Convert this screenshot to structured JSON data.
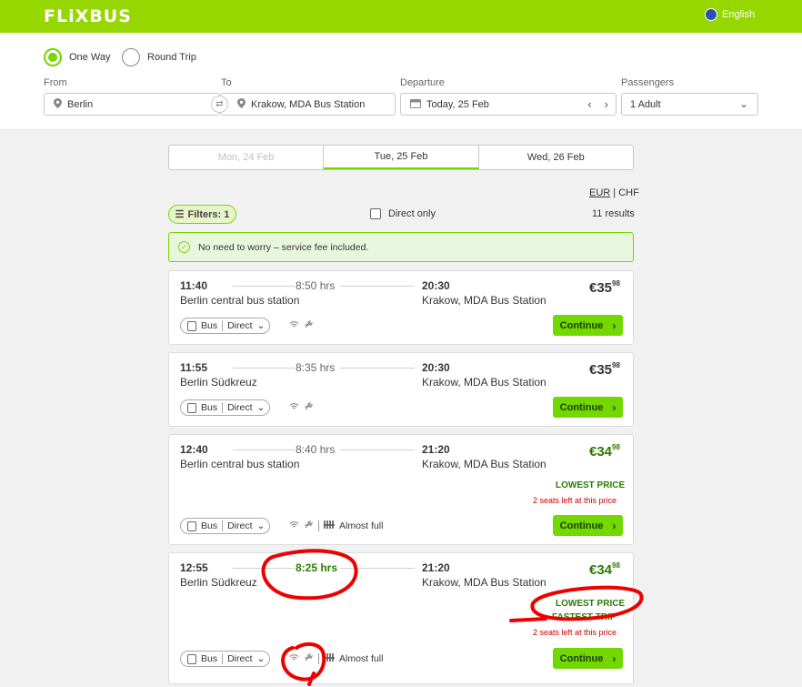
{
  "header": {
    "logo": "FLiXBUS",
    "language": "English"
  },
  "search": {
    "trip_types": [
      "One Way",
      "Round Trip"
    ],
    "selected_trip_type": "One Way",
    "from_label": "From",
    "from_value": "Berlin",
    "to_label": "To",
    "to_value": "Krakow, MDA Bus Station",
    "departure_label": "Departure",
    "departure_value": "Today, 25 Feb",
    "passengers_label": "Passengers",
    "passengers_value": "1 Adult"
  },
  "date_tabs": [
    "Mon, 24 Feb",
    "Tue, 25 Feb",
    "Wed, 26 Feb"
  ],
  "currency": {
    "selected": "EUR",
    "separator": "|",
    "other": "CHF"
  },
  "filters_label": "Filters: 1",
  "direct_only_label": "Direct only",
  "results_count": "11 results",
  "notice": "No need to worry – service fee included.",
  "rides": [
    {
      "dep_time": "11:40",
      "duration": "8:50 hrs",
      "arr_time": "20:30",
      "from": "Berlin central bus station",
      "to": "Krakow, MDA Bus Station",
      "price_main": "€35",
      "price_cents": "98",
      "mode": "Bus",
      "type": "Direct",
      "continue": "Continue"
    },
    {
      "dep_time": "11:55",
      "duration": "8:35 hrs",
      "arr_time": "20:30",
      "from": "Berlin Südkreuz",
      "to": "Krakow, MDA Bus Station",
      "price_main": "€35",
      "price_cents": "98",
      "mode": "Bus",
      "type": "Direct",
      "continue": "Continue"
    },
    {
      "dep_time": "12:40",
      "duration": "8:40 hrs",
      "arr_time": "21:20",
      "from": "Berlin central bus station",
      "to": "Krakow, MDA Bus Station",
      "price_main": "€34",
      "price_cents": "98",
      "lowest": "LOWEST PRICE",
      "seats": "2 seats left at this price",
      "mode": "Bus",
      "type": "Direct",
      "capacity": "Almost full",
      "continue": "Continue"
    },
    {
      "dep_time": "12:55",
      "duration": "8:25 hrs",
      "arr_time": "21:20",
      "from": "Berlin Südkreuz",
      "to": "Krakow, MDA Bus Station",
      "price_main": "€34",
      "price_cents": "98",
      "lowest": "LOWEST PRICE",
      "fastest": "FASTEST TRIP",
      "seats": "2 seats left at this price",
      "mode": "Bus",
      "type": "Direct",
      "capacity": "Almost full",
      "continue": "Continue"
    }
  ],
  "colors": {
    "brand": "#97d700",
    "button": "#73d700",
    "price_green": "#2b7d00",
    "alert": "#cc0000",
    "annotation": "#ee0000"
  },
  "icons": [
    "globe-icon",
    "location-pin-icon",
    "swap-icon",
    "calendar-icon",
    "chevron-left-icon",
    "chevron-right-icon",
    "chevron-down-icon",
    "filter-icon",
    "check-circle-icon",
    "bus-icon",
    "wifi-icon",
    "power-plug-icon",
    "seats-icon",
    "arrow-right-icon"
  ]
}
